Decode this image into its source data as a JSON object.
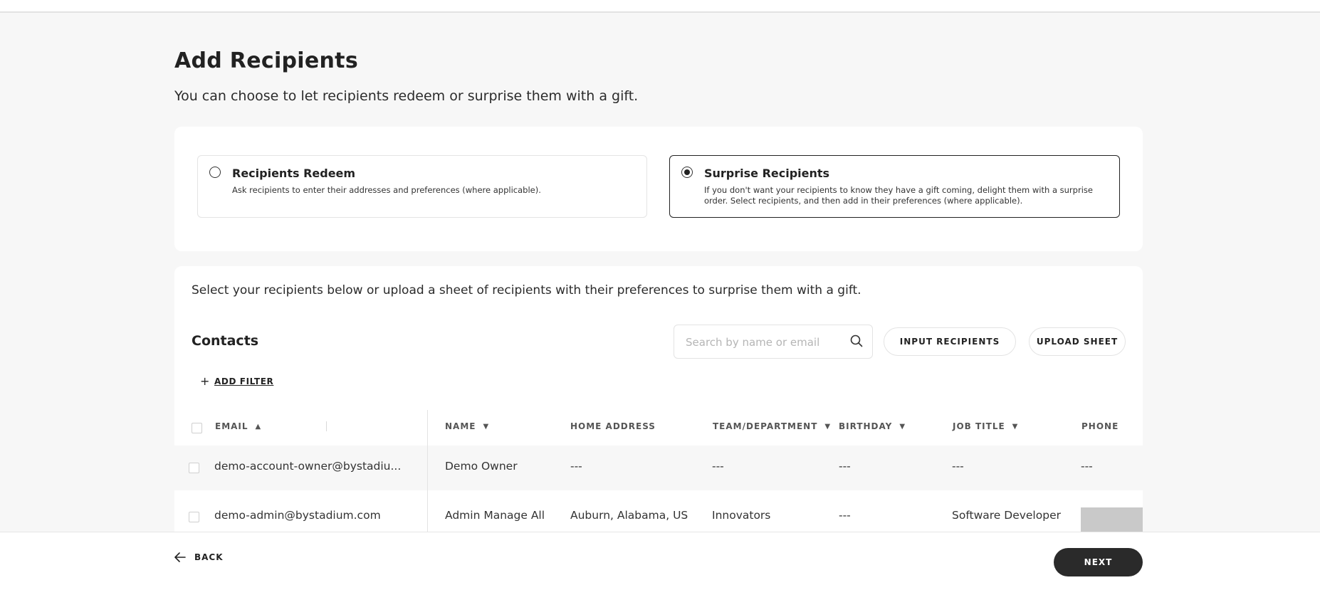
{
  "header": {
    "title": "Add Recipients",
    "subtitle": "You can choose to let recipients redeem or surprise them with a gift."
  },
  "mode_options": [
    {
      "title": "Recipients Redeem",
      "description": "Ask recipients to enter their addresses and preferences (where applicable).",
      "selected": false
    },
    {
      "title": "Surprise Recipients",
      "description": "If you don't want your recipients to know they have a gift coming, delight them with a surprise order. Select recipients, and then add in their preferences (where applicable).",
      "selected": true
    }
  ],
  "recipients": {
    "instructions": "Select your recipients below or upload a sheet of recipients with their preferences to surprise them with a gift.",
    "contacts_title": "Contacts",
    "search_placeholder": "Search by name or email",
    "input_recipients_label": "INPUT RECIPIENTS",
    "upload_sheet_label": "UPLOAD SHEET",
    "add_filter_label": "ADD FILTER"
  },
  "table": {
    "columns": {
      "email": "EMAIL",
      "name": "NAME",
      "home_address": "HOME ADDRESS",
      "team": "TEAM/DEPARTMENT",
      "birthday": "BIRTHDAY",
      "job_title": "JOB TITLE",
      "phone": "PHONE"
    },
    "rows": [
      {
        "email": "demo-account-owner@bystadiu...",
        "name": "Demo Owner",
        "home_address": "---",
        "team": "---",
        "birthday": "---",
        "job_title": "---",
        "phone": "---"
      },
      {
        "email": "demo-admin@bystadium.com",
        "name": "Admin Manage All",
        "home_address": "Auburn, Alabama, US",
        "team": "Innovators",
        "birthday": "---",
        "job_title": "Software Developer",
        "phone": ""
      }
    ]
  },
  "footer": {
    "back_label": "BACK",
    "next_label": "NEXT"
  },
  "colors": {
    "page_bg": "#f7f7f7",
    "card_bg": "#ffffff",
    "primary_button": "#2a2a2a"
  }
}
